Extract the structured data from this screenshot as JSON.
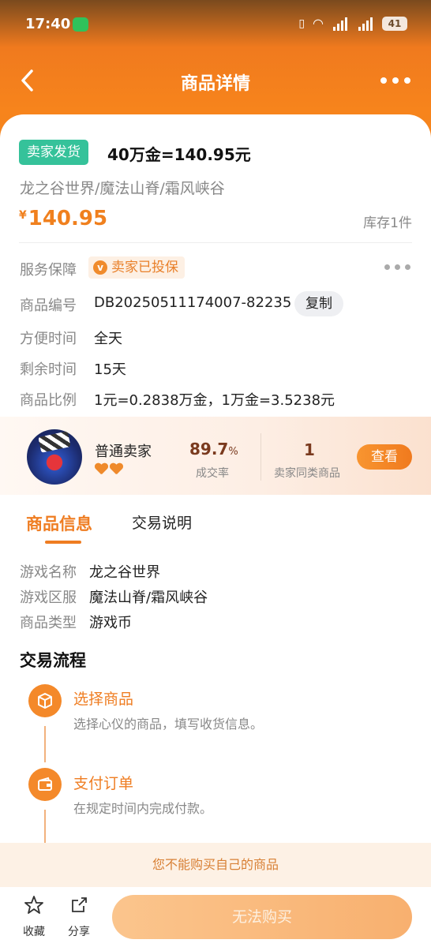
{
  "status_bar": {
    "time": "17:40",
    "battery": "41",
    "net1": "5G",
    "net2": "5G"
  },
  "nav": {
    "title": "商品详情"
  },
  "product": {
    "tag": "卖家发货",
    "title": "40万金=140.95元",
    "subtitle": "龙之谷世界/魔法山脊/霜风峡谷",
    "price_symbol": "¥",
    "price": "140.95",
    "stock": "库存1件"
  },
  "details": [
    {
      "label": "服务保障",
      "value": "卖家已投保"
    },
    {
      "label": "商品编号",
      "value": "DB20250511174007-82235",
      "action": "复制"
    },
    {
      "label": "方便时间",
      "value": "全天"
    },
    {
      "label": "剩余时间",
      "value": "15天"
    },
    {
      "label": "商品比例",
      "value": "1元=0.2838万金，1万金=3.5238元"
    }
  ],
  "seller": {
    "name": "普通卖家",
    "hearts": 2,
    "rate_value": "89.7",
    "rate_unit": "%",
    "rate_label": "成交率",
    "same_count": "1",
    "same_label": "卖家同类商品",
    "view_button": "查看"
  },
  "tabs": [
    {
      "label": "商品信息",
      "active": true
    },
    {
      "label": "交易说明",
      "active": false
    }
  ],
  "info": [
    {
      "label": "游戏名称",
      "value": "龙之谷世界"
    },
    {
      "label": "游戏区服",
      "value": "魔法山脊/霜风峡谷"
    },
    {
      "label": "商品类型",
      "value": "游戏币"
    }
  ],
  "flow": {
    "title": "交易流程",
    "steps": [
      {
        "title": "选择商品",
        "desc": "选择心仪的商品，填写收货信息。",
        "icon": "box-icon"
      },
      {
        "title": "支付订单",
        "desc": "在规定时间内完成付款。",
        "icon": "wallet-icon"
      }
    ]
  },
  "warning": "您不能购买自己的商品",
  "bottom": {
    "favorite": "收藏",
    "share": "分享",
    "buy": "无法购买"
  },
  "colors": {
    "accent": "#f07a1e",
    "tag_green": "#35c29a",
    "price": "#f0801e"
  }
}
